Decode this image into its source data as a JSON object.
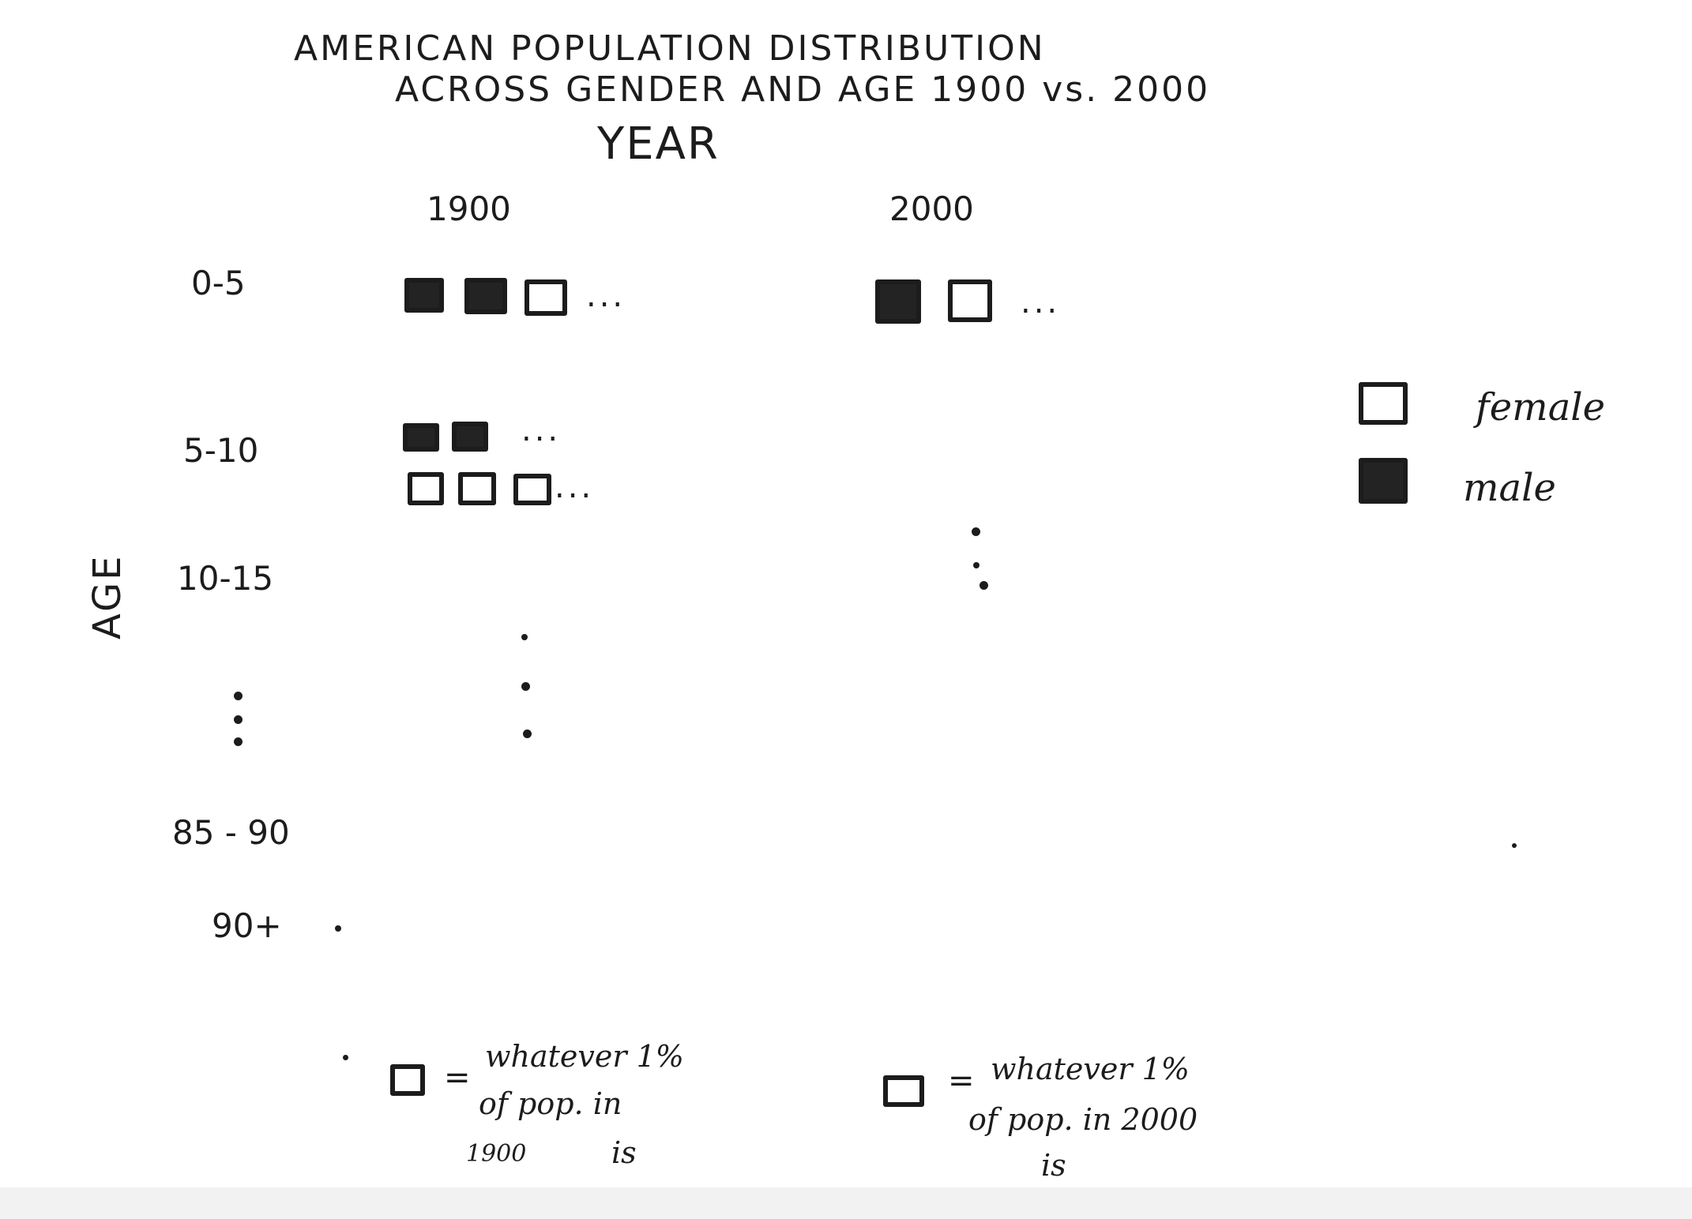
{
  "title": {
    "line1": "AMERICAN POPULATION DISTRIBUTION",
    "line2": "ACROSS GENDER AND AGE 1900 vs. 2000"
  },
  "axes": {
    "columns_label": "YEAR",
    "rows_label": "AGE",
    "columns": [
      "1900",
      "2000"
    ],
    "rows": [
      "0-5",
      "5-10",
      "10-15",
      "85 - 90",
      "90+"
    ]
  },
  "cells": {
    "r0_1900": {
      "male_squares": 2,
      "female_squares": 1
    },
    "r0_2000": {
      "male_squares": 1,
      "female_squares": 1
    },
    "r1_1900": {
      "male_squares": 2,
      "female_squares": 3
    }
  },
  "ellipsis": "...",
  "legend": {
    "female": "female",
    "male": "male"
  },
  "notes": {
    "n1900": {
      "eq": "=",
      "line1": "whatever 1%",
      "line2": "of pop. in",
      "line3": "1900",
      "line4": "is"
    },
    "n2000": {
      "eq": "=",
      "line1": "whatever 1%",
      "line2": "of pop. in 2000",
      "line3": "is"
    }
  },
  "colors": {
    "ink": "#1c1c1c",
    "male_fill": "#232323",
    "female_fill": "#ffffff"
  }
}
